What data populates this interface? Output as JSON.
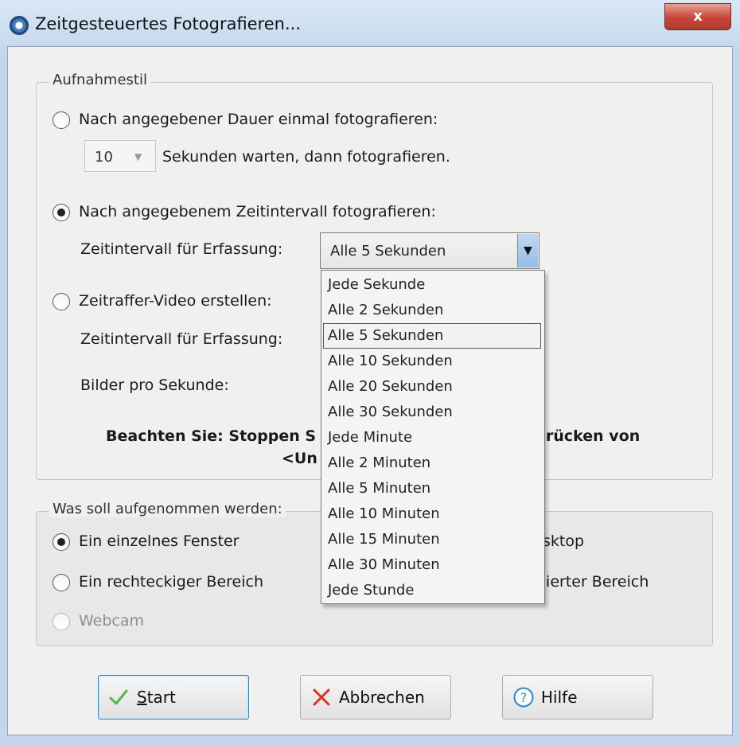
{
  "window": {
    "title": "Zeitgesteuertes Fotografieren...",
    "close_symbol": "x"
  },
  "capture_style": {
    "legend": "Aufnahmestil",
    "option_once": {
      "label": "Nach angegebener Dauer einmal fotografieren:",
      "checked": false,
      "delay_value": "10",
      "delay_suffix": "Sekunden warten, dann fotografieren."
    },
    "option_interval": {
      "label": "Nach angegebenem Zeitintervall fotografieren:",
      "checked": true,
      "interval_label": "Zeitintervall für Erfassung:",
      "interval_value": "Alle 5 Sekunden"
    },
    "option_timelapse": {
      "label": "Zeitraffer-Video erstellen:",
      "checked": false,
      "interval_label": "Zeitintervall für Erfassung:",
      "fps_label": "Bilder pro Sekunde:"
    },
    "note_left": "Beachten Sie: Stoppen S",
    "note_right": "rücken von",
    "note_line2": "<Un"
  },
  "interval_dropdown": {
    "options": [
      "Jede Sekunde",
      "Alle 2 Sekunden",
      "Alle 5 Sekunden",
      "Alle 10 Sekunden",
      "Alle 20 Sekunden",
      "Alle 30 Sekunden",
      "Jede Minute",
      "Alle 2 Minuten",
      "Alle 5 Minuten",
      "Alle 10 Minuten",
      "Alle 15 Minuten",
      "Alle 30 Minuten",
      "Jede Stunde"
    ],
    "selected": "Alle 5 Sekunden"
  },
  "capture_target": {
    "legend": "Was soll aufgenommen werden:",
    "single_window": {
      "label": "Ein einzelnes Fenster",
      "checked": true
    },
    "desktop_partial": "sktop",
    "rect_area": {
      "label": "Ein rechteckiger Bereich",
      "checked": false
    },
    "defined_area_partial": "nierter Bereich",
    "webcam": {
      "label": "Webcam",
      "checked": false,
      "disabled": true
    }
  },
  "buttons": {
    "start": {
      "label_first": "S",
      "label_rest": "tart",
      "icon": "checkmark-icon"
    },
    "cancel": {
      "label": "Abbrechen",
      "icon": "x-icon"
    },
    "help": {
      "label": "Hilfe",
      "icon": "question-icon"
    }
  },
  "colors": {
    "accent": "#3c7fb1",
    "close_red": "#c7443a",
    "check_green": "#56b848",
    "cancel_red": "#d9342b",
    "help_blue": "#2f86c8"
  }
}
